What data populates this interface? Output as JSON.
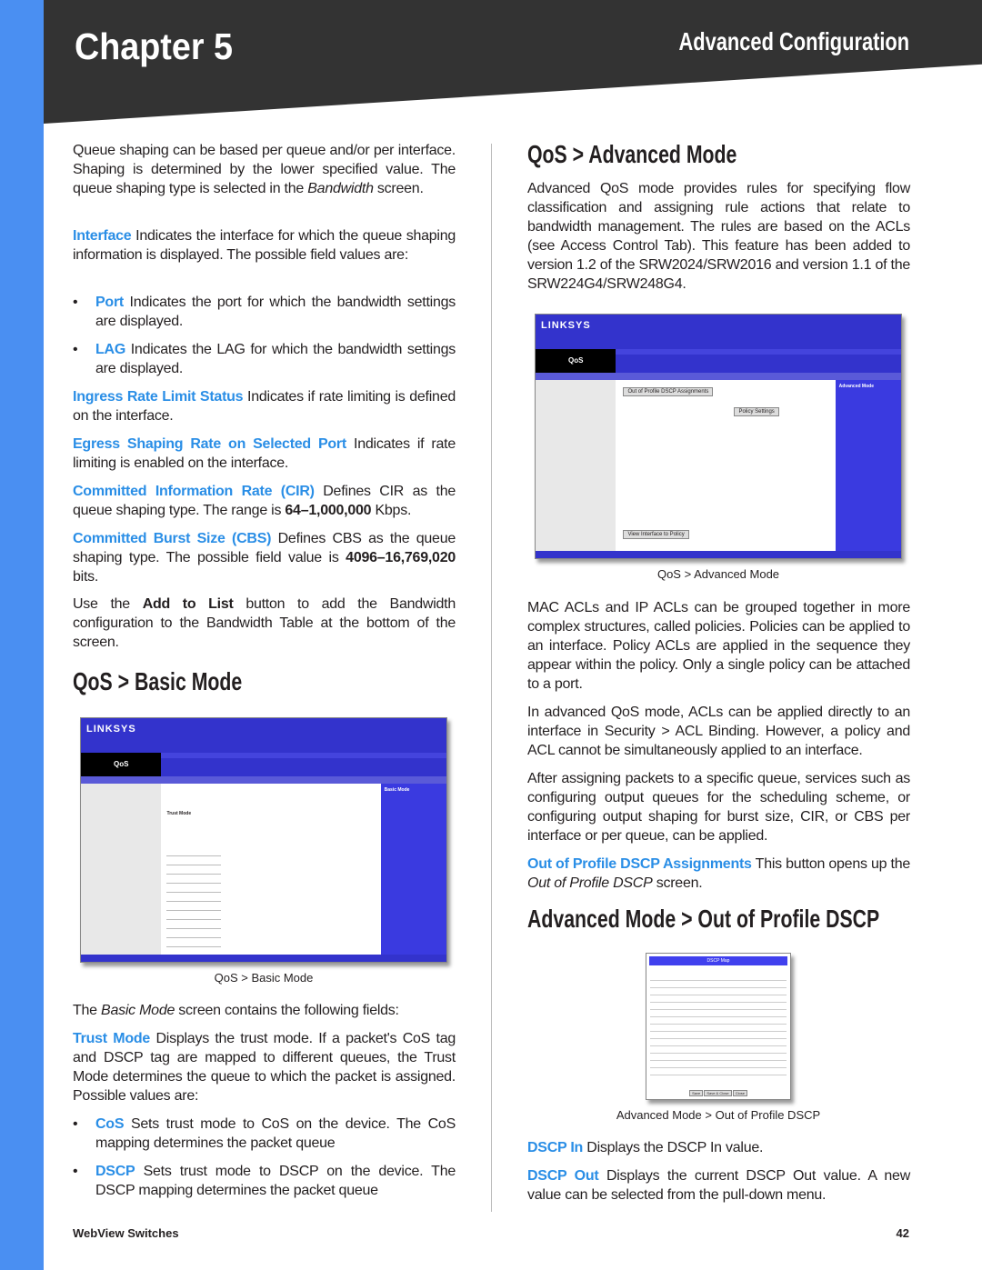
{
  "header": {
    "chapter": "Chapter 5",
    "section": "Advanced Configuration"
  },
  "left": {
    "p1_a": "Queue shaping can be based per queue and/or per interface. Shaping is determined by the lower specified value. The queue shaping type is selected in the ",
    "p1_em": "Bandwidth",
    "p1_b": " screen.",
    "interface_term": "Interface",
    "interface_text": " Indicates the interface for which the queue shaping information is displayed. The possible field values are:",
    "port_term": "Port",
    "port_text": " Indicates the port for which the bandwidth settings are displayed.",
    "lag_term": "LAG",
    "lag_text": " Indicates the LAG for which the bandwidth settings are displayed.",
    "ingress_term": "Ingress Rate Limit Status",
    "ingress_text": " Indicates if rate limiting is defined on the interface.",
    "egress_term": "Egress Shaping Rate on Selected Port",
    "egress_text": " Indicates if rate limiting is enabled on the interface.",
    "cir_term": "Committed Information Rate (CIR)",
    "cir_text": " Defines CIR as the queue shaping type. The range is ",
    "cir_range": "64–1,000,000",
    "cir_unit": " Kbps.",
    "cbs_term": "Committed Burst Size (CBS)",
    "cbs_text": " Defines CBS as the queue shaping type. The possible field value is ",
    "cbs_range": "4096–16,769,020",
    "cbs_unit": " bits.",
    "add_a": "Use the ",
    "add_b": "Add to List",
    "add_c": " button to add the Bandwidth configuration to the Bandwidth Table at the bottom of the screen.",
    "basic_heading": "QoS > Basic Mode",
    "basic_caption": "QoS > Basic Mode",
    "basic_intro_a": "The ",
    "basic_intro_em": "Basic Mode",
    "basic_intro_b": " screen contains the following fields:",
    "trust_term": "Trust Mode",
    "trust_text": " Displays the trust mode. If a packet's CoS tag and DSCP tag are mapped to different queues, the Trust Mode determines the queue to which the packet is assigned. Possible values are:",
    "cos_term": "CoS",
    "cos_text": " Sets trust mode to CoS on the device. The CoS mapping determines the packet queue",
    "dscp_term": "DSCP",
    "dscp_text": " Sets trust mode to DSCP on the device. The DSCP mapping determines the packet queue"
  },
  "right": {
    "adv_heading": "QoS > Advanced Mode",
    "adv_text": "Advanced QoS mode provides rules for specifying flow classification and assigning rule actions that relate to bandwidth management. The rules are based on the ACLs (see Access Control Tab). This feature has been added to version 1.2 of the SRW2024/SRW2016 and version 1.1 of the SRW224G4/SRW248G4.",
    "adv_caption": "QoS > Advanced Mode",
    "mac_text": "MAC ACLs and IP ACLs can be grouped together in more complex structures, called policies. Policies can be applied to an interface. Policy ACLs are applied in the sequence they appear within the policy. Only a single policy can be attached to a port.",
    "inadv_text": "In advanced QoS mode, ACLs can be applied directly to an interface in Security > ACL Binding. However, a policy and ACL cannot be simultaneously applied to an interface.",
    "after_text": "After assigning packets to a specific queue, services such as configuring output queues for the scheduling scheme, or configuring output shaping for burst size, CIR, or CBS per interface or per queue, can be applied.",
    "oop_term": "Out of Profile DSCP Assignments",
    "oop_text_a": "  This button opens up the ",
    "oop_em": "Out of Profile DSCP",
    "oop_text_b": " screen.",
    "oop_heading": "Advanced Mode > Out of Profile DSCP",
    "oop_caption": "Advanced Mode > Out of Profile DSCP",
    "dscpin_term": "DSCP In",
    "dscpin_text": "  Displays the DSCP In value.",
    "dscpout_term": "DSCP Out",
    "dscpout_text": "  Displays the current DSCP Out value. A new value can be selected from the pull-down menu."
  },
  "screens": {
    "logo": "LINKSYS",
    "qos": "QoS",
    "adv_help": "Advanced Mode",
    "adv_btn1": "Out of Profile DSCP Assignments",
    "adv_btn2": "Policy Settings",
    "adv_btn3": "View Interface to Policy",
    "basic_help": "Basic Mode",
    "basic_trust": "Trust Mode",
    "dscp_map": "DSCP Map",
    "dscp_save": "Save",
    "dscp_save_close": "Save & Close",
    "dscp_close": "Close"
  },
  "footer": {
    "left": "WebView Switches",
    "page": "42"
  },
  "colors": {
    "accent": "#2a8ee6",
    "strip": "#4a8ff2",
    "banner": "#333333"
  }
}
